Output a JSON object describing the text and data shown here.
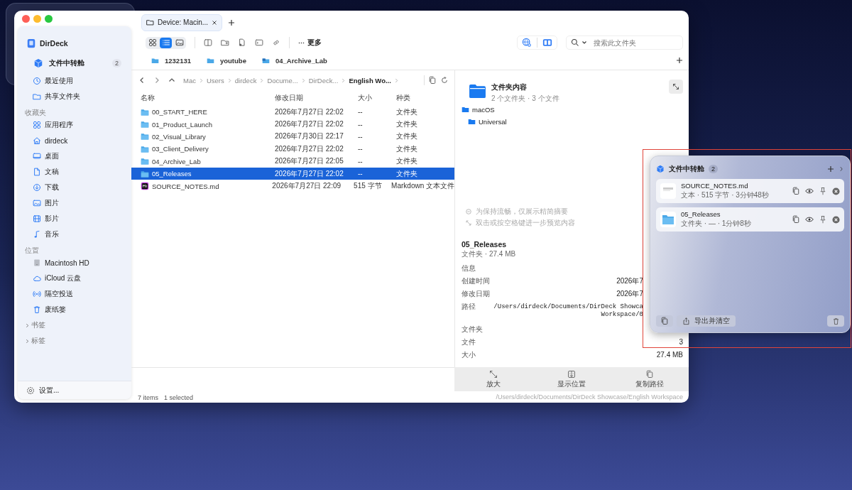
{
  "tabs": [
    {
      "label": "Device: Macin...",
      "selected": true
    }
  ],
  "sidebar": {
    "app_name": "DirDeck",
    "transfer": {
      "label": "文件中转舱",
      "count": "2"
    },
    "top_items": [
      "最近使用",
      "共享文件夹"
    ],
    "sections": [
      {
        "title": "收藏夹",
        "items": [
          "应用程序",
          "dirdeck",
          "桌面",
          "文稿",
          "下载",
          "图片",
          "影片",
          "音乐"
        ]
      },
      {
        "title": "位置",
        "items": [
          "Macintosh HD",
          "iCloud 云盘",
          "隔空投送",
          "废纸篓"
        ]
      }
    ],
    "groups": [
      {
        "label": "书签",
        "expanded": false
      },
      {
        "label": "标签",
        "expanded": false
      }
    ],
    "settings": "设置..."
  },
  "toolbar": {
    "view_modes": [
      {
        "selected": false
      },
      {
        "selected": true
      },
      {
        "selected": false
      }
    ],
    "more": "更多",
    "search": {
      "placeholder": "搜索此文件夹"
    }
  },
  "favorites": [
    {
      "label": "1232131",
      "kind": "folder"
    },
    {
      "label": "youtube",
      "kind": "folder"
    },
    {
      "label": "04_Archive_Lab",
      "kind": "alias"
    }
  ],
  "path_bar": {
    "crumbs": [
      "Mac",
      "Users",
      "dirdeck",
      "Docume...",
      "DirDeck...",
      "English Wo..."
    ]
  },
  "table": {
    "columns": [
      "名称",
      "修改日期",
      "大小",
      "种类"
    ],
    "rows": [
      {
        "name": "00_START_HERE",
        "modified": "2026年7月27日 22:02",
        "size": "--",
        "kind_label": "文件夹",
        "kind": "folder",
        "selected": false
      },
      {
        "name": "01_Product_Launch",
        "modified": "2026年7月27日 22:02",
        "size": "--",
        "kind_label": "文件夹",
        "kind": "folder",
        "selected": false
      },
      {
        "name": "02_Visual_Library",
        "modified": "2026年7月30日 22:17",
        "size": "--",
        "kind_label": "文件夹",
        "kind": "folder",
        "selected": false
      },
      {
        "name": "03_Client_Delivery",
        "modified": "2026年7月27日 22:02",
        "size": "--",
        "kind_label": "文件夹",
        "kind": "folder",
        "selected": false
      },
      {
        "name": "04_Archive_Lab",
        "modified": "2026年7月27日 22:05",
        "size": "--",
        "kind_label": "文件夹",
        "kind": "folder",
        "selected": false
      },
      {
        "name": "05_Releases",
        "modified": "2026年7月27日 22:02",
        "size": "--",
        "kind_label": "文件夹",
        "kind": "folder",
        "selected": true
      },
      {
        "name": "SOURCE_NOTES.md",
        "modified": "2026年7月27日 22:09",
        "size": "515 字节",
        "kind_label": "Markdown 文本文件",
        "kind": "markdown",
        "selected": false
      }
    ]
  },
  "status_bar": {
    "count": "7 items",
    "selection": "1 selected",
    "path": "/Users/dirdeck/Documents/DirDeck Showcase/English Workspace"
  },
  "preview": {
    "title": "文件夹内容",
    "summary": "2 个文件夹 · 3 个文件",
    "tree": [
      {
        "label": "macOS",
        "children": [
          {
            "label": "Universal"
          }
        ]
      }
    ],
    "notes": [
      "为保持流畅，仅展示精简摘要",
      "双击或按空格键进一步预览内容"
    ],
    "name": "05_Releases",
    "subtitle": "文件夹 · 27.4 MB",
    "info_heading": "信息",
    "info": [
      {
        "label": "创建时间",
        "value_lines": [
          "2026年7"
        ]
      },
      {
        "label": "修改日期",
        "value_lines": [
          "2026年7"
        ]
      },
      {
        "label": "路径",
        "value_lines": [
          "/Users/dirdeck/Documents/DirDeck Showca",
          "Workspace/0"
        ]
      },
      {
        "label": "文件夹"
      },
      {
        "label": "文件",
        "value_lines": [
          "3"
        ]
      },
      {
        "label": "大小",
        "value_lines": [
          "27.4 MB"
        ]
      }
    ],
    "actions": [
      "放大",
      "显示位置",
      "复制路径"
    ]
  },
  "transfer_panel": {
    "title": "文件中转舱",
    "count": "2",
    "items": [
      {
        "name": "SOURCE_NOTES.md",
        "meta": "文本 · 515 字节 · 3分钟48秒",
        "kind": "text"
      },
      {
        "name": "05_Releases",
        "meta": "文件夹 · — · 1分钟8秒",
        "kind": "folder"
      }
    ],
    "export_label": "导出并清空"
  }
}
